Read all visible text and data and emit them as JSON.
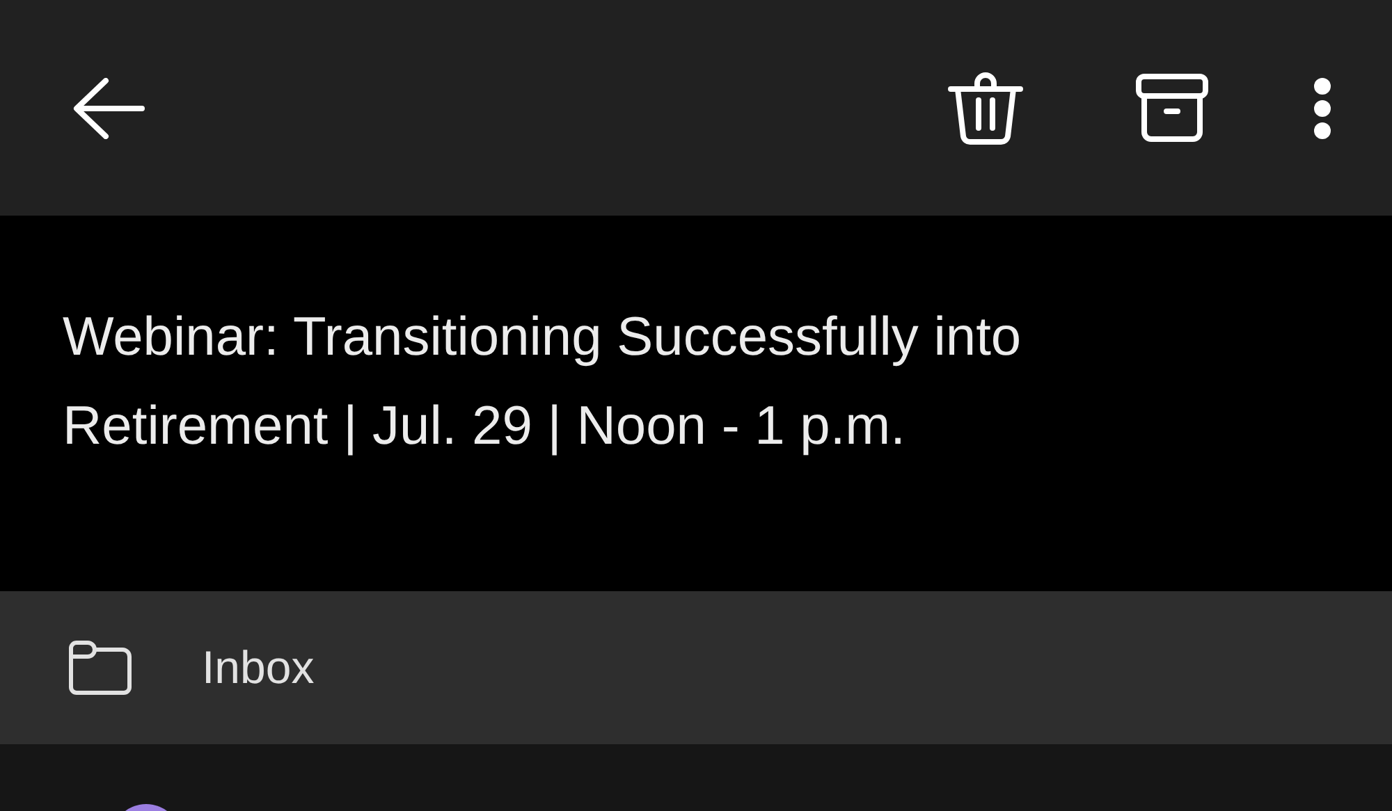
{
  "subject": "Webinar: Transitioning Successfully into Retirement | Jul. 29 | Noon - 1 p.m.",
  "folder": {
    "label": "Inbox"
  }
}
